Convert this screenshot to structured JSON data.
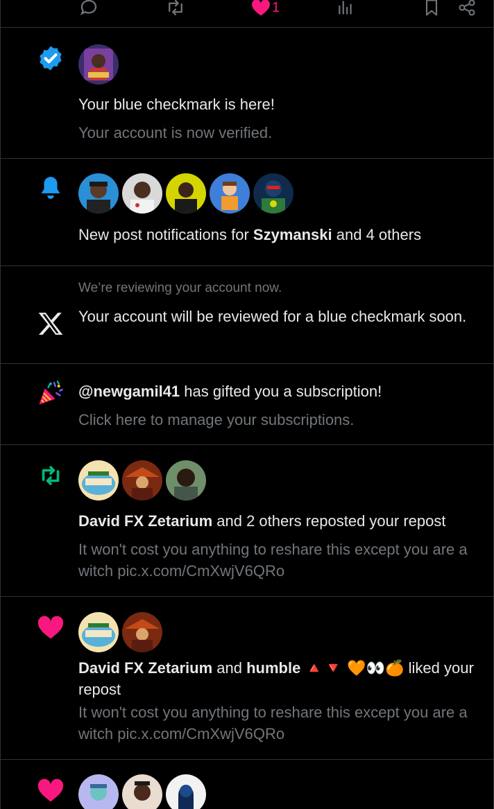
{
  "action_bar": {
    "like_count": "1",
    "like_color": "#f91880"
  },
  "notifications": [
    {
      "type": "verified",
      "icon": "verified-badge-icon",
      "icon_color": "#1d9bf0",
      "title": "Your blue checkmark is here!",
      "subtitle": "Your account is now verified."
    },
    {
      "type": "new-post",
      "icon": "bell-icon",
      "icon_color": "#1d9bf0",
      "title_prefix": "New post notifications for ",
      "title_user": "Szymanski",
      "title_suffix": " and 4 others"
    },
    {
      "type": "review",
      "icon": "x-logo-icon",
      "pre_text": "We’re reviewing your account now.",
      "title": "Your account will be reviewed for a blue checkmark soon."
    },
    {
      "type": "gift",
      "icon": "party-popper-icon",
      "title_user": "@newgamil41",
      "title_suffix": " has gifted you a subscription!",
      "subtitle": "Click here to manage your subscriptions."
    },
    {
      "type": "repost",
      "icon": "repost-icon",
      "icon_color": "#00ba7c",
      "title_user": "David FX Zetarium",
      "title_suffix": " and 2 others reposted your repost",
      "subtitle": "It won't cost you anything to reshare this except you are a witch pic.x.com/CmXwjV6QRo"
    },
    {
      "type": "like",
      "icon": "heart-icon",
      "icon_color": "#f91880",
      "title_user": "David FX Zetarium",
      "title_and": " and ",
      "title_user2": "humble 🔺🔻 🧡👀🍊",
      "title_suffix": " liked your repost",
      "subtitle": "It won't cost you anything to reshare this except you are a witch pic.x.com/CmXwjV6QRo"
    },
    {
      "type": "like",
      "icon": "heart-icon",
      "icon_color": "#f91880"
    }
  ]
}
